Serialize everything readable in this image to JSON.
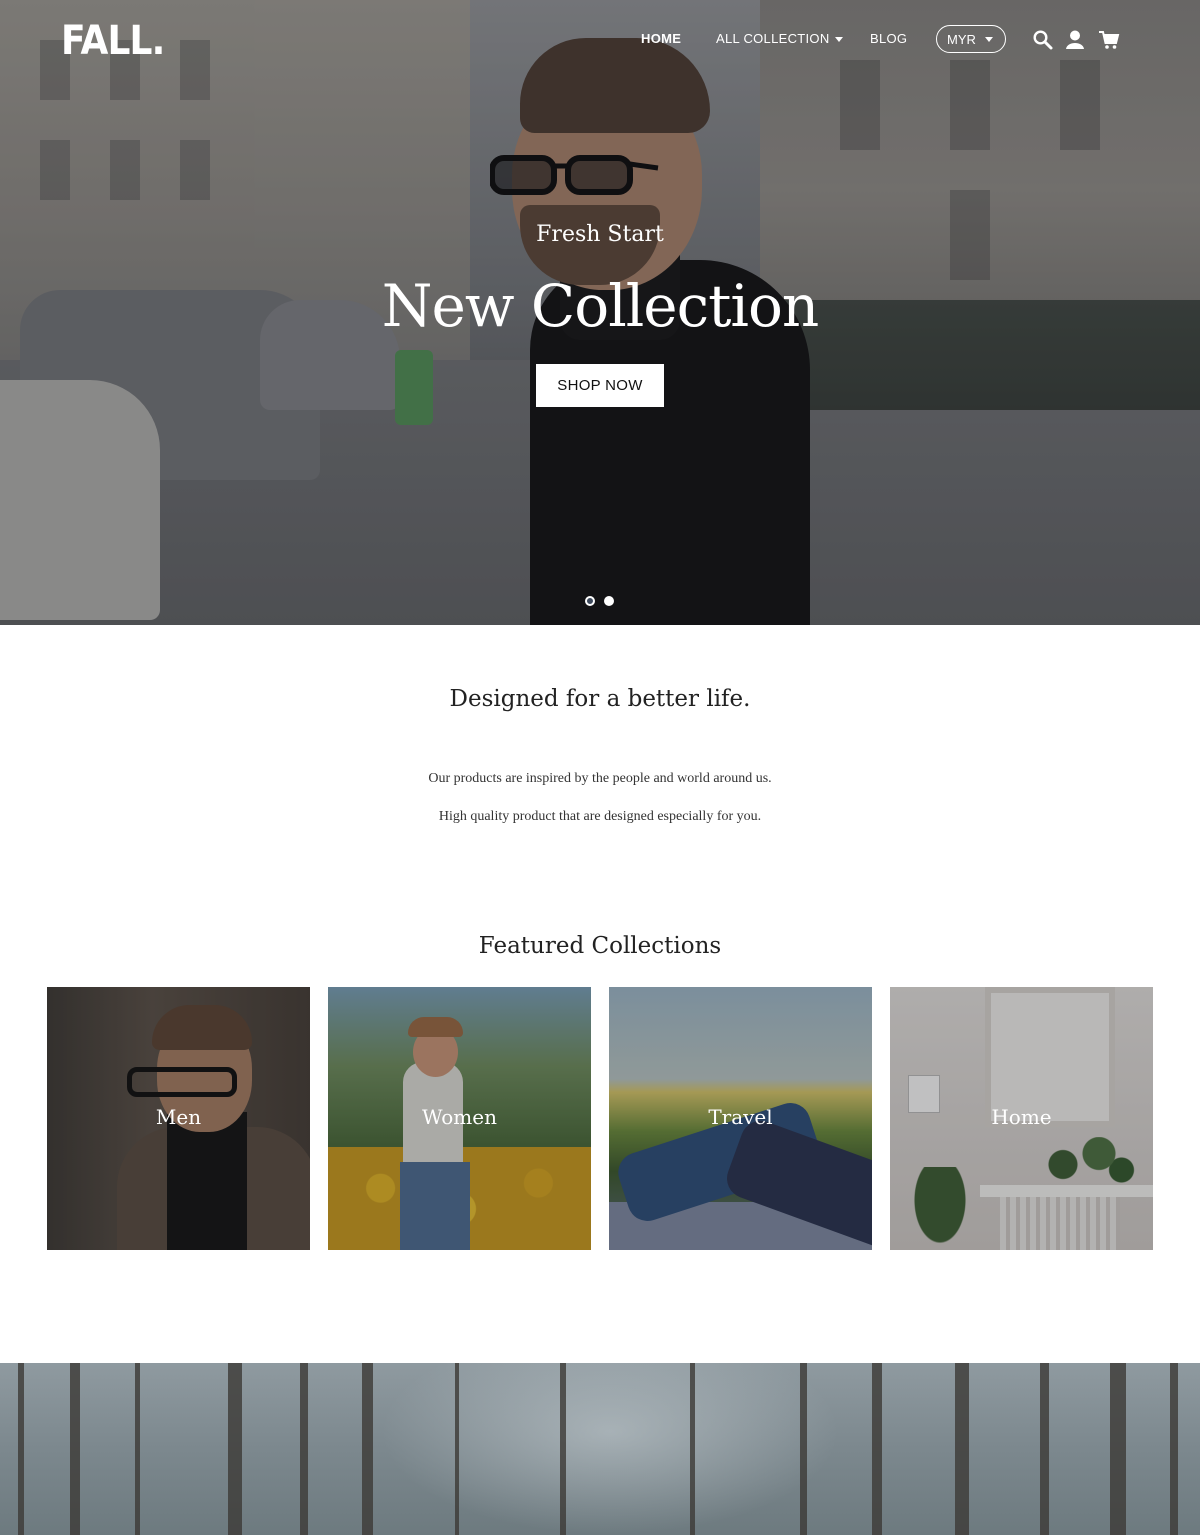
{
  "brand": {
    "logo": "FALL."
  },
  "nav": {
    "home": "HOME",
    "all_collection": "ALL COLLECTION",
    "blog": "BLOG",
    "currency": "MYR"
  },
  "icons": [
    "search-icon",
    "account-icon",
    "cart-icon"
  ],
  "hero": {
    "subtitle": "Fresh Start",
    "title": "New Collection",
    "cta": "SHOP NOW",
    "slides": 2,
    "active_slide": 1
  },
  "intro": {
    "title": "Designed for a better life.",
    "line1": "Our products are inspired by the people and world around us.",
    "line2": "High quality product that are designed especially for you."
  },
  "featured": {
    "title": "Featured Collections",
    "items": [
      {
        "label": "Men"
      },
      {
        "label": "Women"
      },
      {
        "label": "Travel"
      },
      {
        "label": "Home"
      }
    ]
  },
  "colors": {
    "text": "#222222",
    "white": "#ffffff"
  }
}
